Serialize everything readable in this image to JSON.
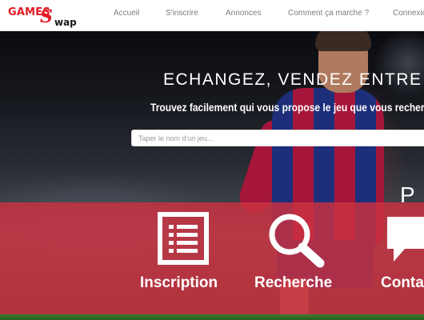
{
  "brand": {
    "logo_games": "GAMES",
    "logo_s": "S",
    "logo_wap": "wap",
    "accent_color": "#e31b23"
  },
  "nav": {
    "items": [
      {
        "label": "Accueil"
      },
      {
        "label": "S'inscrire"
      },
      {
        "label": "Annonces"
      },
      {
        "label": "Comment ça marche ?"
      },
      {
        "label": "Connexion"
      }
    ]
  },
  "hero": {
    "title": "ECHANGEZ, VENDEZ ENTRE",
    "subtitle": "Trouvez facilement qui vous propose le jeu que vous recherchez",
    "search_placeholder": "Taper le nom d'un jeu..."
  },
  "section": {
    "letter": "P"
  },
  "features": [
    {
      "label": "Inscription",
      "icon": "form-list-icon"
    },
    {
      "label": "Recherche",
      "icon": "magnifier-icon"
    },
    {
      "label": "Contact",
      "icon": "chat-bubble-icon"
    }
  ],
  "band_color": "#c93140"
}
